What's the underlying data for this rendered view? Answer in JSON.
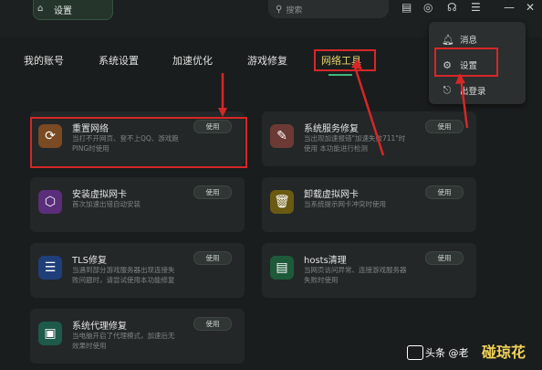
{
  "topbar": {
    "active_tab": "设置",
    "search_placeholder": "搜索"
  },
  "nav": {
    "tabs": [
      "我的账号",
      "系统设置",
      "加速优化",
      "游戏修复",
      "网络工具"
    ],
    "active": "网络工具"
  },
  "cards": [
    {
      "icon": "refresh-icon",
      "title": "重置网络",
      "desc": "当打不开网页、登不上QQ、游戏跑PING时使用",
      "button": "使用",
      "color": "#7a4a22"
    },
    {
      "icon": "wrench-icon",
      "title": "系统服务修复",
      "desc": "当出现加速报错\"加速失败711\"时使用 本功能进行检测",
      "button": "使用",
      "color": "#6b3a34"
    },
    {
      "icon": "cube-icon",
      "title": "安装虚拟网卡",
      "desc": "首次加速出错自动安装",
      "button": "使用",
      "color": "#5a2e7a"
    },
    {
      "icon": "trash-icon",
      "title": "卸载虚拟网卡",
      "desc": "当系统提示网卡冲突时使用",
      "button": "使用",
      "color": "#6a5a12"
    },
    {
      "icon": "list-icon",
      "title": "TLS修复",
      "desc": "当遇到部分游戏服务器出现连接失败问题时，请尝试使用本功能修复",
      "button": "使用",
      "color": "#1f3f7a"
    },
    {
      "icon": "doc-icon",
      "title": "hosts清理",
      "desc": "当网页访问异常、连接游戏服务器失败时使用",
      "button": "使用",
      "color": "#1e5a3a"
    },
    {
      "icon": "monitor-icon",
      "title": "系统代理修复",
      "desc": "当电脑开启了代理模式，加速后无效果时使用",
      "button": "使用",
      "color": "#1e5a4a"
    }
  ],
  "menu": [
    {
      "icon": "bell-icon",
      "label": "消息"
    },
    {
      "icon": "gear-icon",
      "label": "设置"
    },
    {
      "icon": "logout-icon",
      "label": "出登录"
    }
  ],
  "watermark": {
    "prefix": "头条",
    "at": "@老",
    "corner": "碰琼花"
  }
}
